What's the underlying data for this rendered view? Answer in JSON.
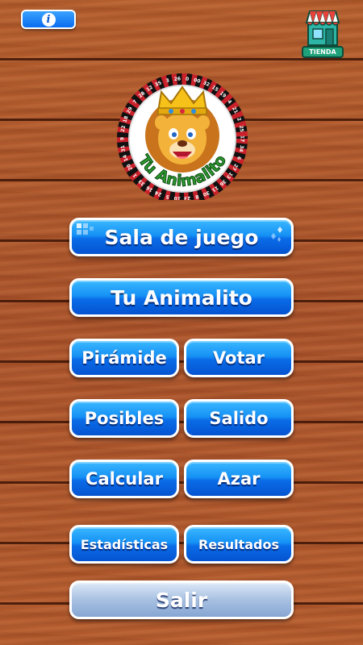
{
  "header": {
    "info_icon": "info-icon",
    "store": {
      "label": "TIENDA",
      "icon": "store-icon"
    }
  },
  "logo": {
    "text": "Tu Animalito",
    "roulette_numbers": [
      "0",
      "00",
      "32",
      "15",
      "19",
      "4",
      "21",
      "2",
      "25",
      "17",
      "34",
      "6",
      "27",
      "13",
      "36",
      "11",
      "30",
      "8",
      "23",
      "10",
      "5",
      "24",
      "16",
      "33",
      "1",
      "20",
      "14",
      "31",
      "9",
      "22",
      "18",
      "29",
      "7",
      "28",
      "12",
      "35",
      "3",
      "26"
    ]
  },
  "menu": {
    "sala": "Sala de juego",
    "tu_animalito": "Tu Animalito",
    "piramide": "Pirámide",
    "votar": "Votar",
    "posibles": "Posibles",
    "salido": "Salido",
    "calcular": "Calcular",
    "azar": "Azar",
    "estadisticas": "Estadísticas",
    "resultados": "Resultados",
    "salir": "Salir"
  },
  "colors": {
    "button_blue": "#0a6ce8",
    "button_exit": "#a8c1e2",
    "wood": "#b0582a"
  }
}
